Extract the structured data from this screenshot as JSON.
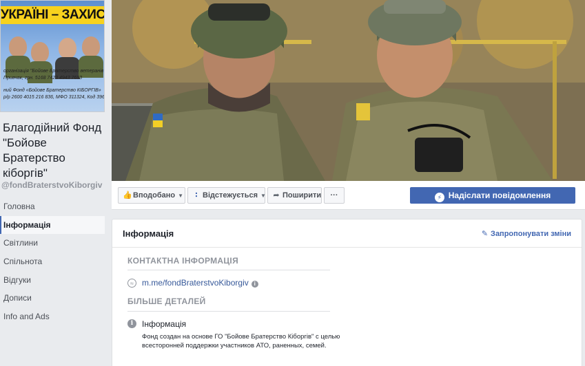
{
  "profile": {
    "banner_text": "УКРАЇНІ – ЗАХИСТ",
    "pic_lines": [
      "організація \"Бойове Братерство ветеранів АТ",
      "Привчак, грн. 5168 7423 4943 7693",
      "ний Фонд «Бойове Братерство КІБОРГІВ»",
      "р/р 2600 4015 216 836, МФО 311324, Код 396"
    ],
    "name": "Благодійний Фонд \"Бойове Братерство кіборгів\"",
    "handle": "@fondBraterstvoKiborgiv"
  },
  "nav": {
    "items": [
      {
        "label": "Головна",
        "active": false
      },
      {
        "label": "Інформація",
        "active": true
      },
      {
        "label": "Світлини",
        "active": false
      },
      {
        "label": "Спільнота",
        "active": false
      },
      {
        "label": "Відгуки",
        "active": false
      },
      {
        "label": "Дописи",
        "active": false
      },
      {
        "label": "Info and Ads",
        "active": false
      }
    ]
  },
  "actions": {
    "liked": "Вподобано",
    "following": "Відстежується",
    "share": "Поширити",
    "more": "···",
    "send_message": "Надіслати повідомлення"
  },
  "info_card": {
    "title": "Інформація",
    "suggest_edits": "Запропонувати зміни",
    "contact_header": "КОНТАКТНА ІНФОРМАЦІЯ",
    "messenger_link": "m.me/fondBraterstvoKiborgiv",
    "more_details_header": "БІЛЬШЕ ДЕТАЛЕЙ",
    "about_label": "Інформація",
    "about_text": "Фонд создан на основе ГО \"Бойове Братерство Кіборгів\" с целью всесторонней поддержки участников АТО, раненных, семей."
  },
  "icons": {
    "liked": "thumbs-up-icon",
    "following": "rss-icon",
    "share": "share-arrow-icon",
    "messenger": "messenger-icon",
    "suggest": "pencil-icon",
    "about": "info-icon"
  },
  "colors": {
    "brand": "#4267b2",
    "link": "#365899",
    "background": "#e9ebee",
    "muted": "#90949c"
  }
}
